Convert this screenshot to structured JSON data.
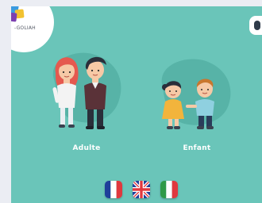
{
  "app": {
    "logo_text": "-GOLIAH",
    "logo_colors": [
      "#e8413b",
      "#3a9be0",
      "#f2c230",
      "#7c3fb0"
    ]
  },
  "choices": [
    {
      "id": "adult",
      "label": "Adulte"
    },
    {
      "id": "child",
      "label": "Enfant"
    }
  ],
  "languages": [
    {
      "code": "fr",
      "icon": "flag-france-icon"
    },
    {
      "code": "en",
      "icon": "flag-uk-icon"
    },
    {
      "code": "it",
      "icon": "flag-italy-icon"
    }
  ],
  "colors": {
    "background": "#6ac5b9",
    "blob": "#57b3a7",
    "label": "#ffffff"
  }
}
